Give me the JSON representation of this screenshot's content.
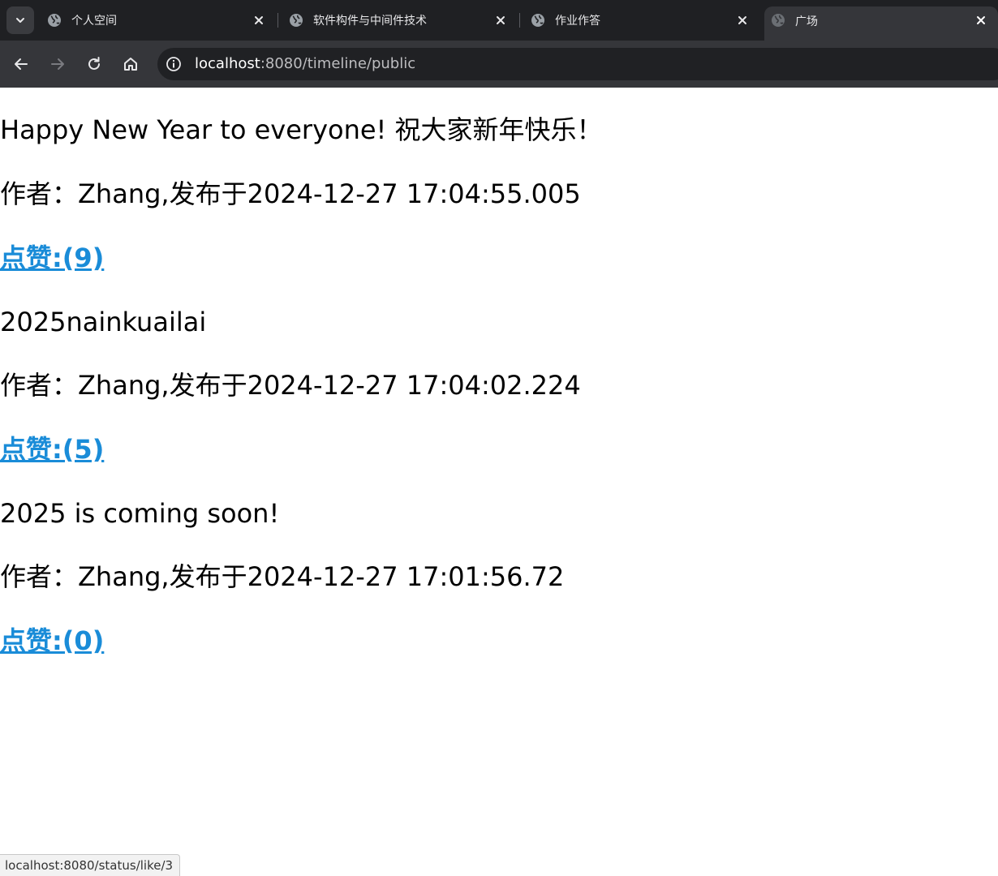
{
  "browser": {
    "tabs": [
      {
        "title": "个人空间",
        "active": false
      },
      {
        "title": "软件构件与中间件技术",
        "active": false
      },
      {
        "title": "作业作答",
        "active": false
      },
      {
        "title": "广场",
        "active": true
      }
    ],
    "address_bar": {
      "host": "localhost",
      "rest": ":8080/timeline/public"
    },
    "icons": {
      "tab_search": "chevron-down-icon",
      "tab_favicon": "globe-icon",
      "tab_close": "close-icon",
      "back": "arrow-left-icon",
      "forward": "arrow-right-icon",
      "reload": "reload-icon",
      "home": "home-icon",
      "site_info": "info-icon"
    }
  },
  "posts": [
    {
      "content": "Happy New Year to everyone! 祝大家新年快乐！",
      "meta": "作者：Zhang,发布于2024-12-27 17:04:55.005",
      "like_label": "点赞:(9)"
    },
    {
      "content": "2025nainkuailai",
      "meta": "作者：Zhang,发布于2024-12-27 17:04:02.224",
      "like_label": "点赞:(5)"
    },
    {
      "content": "2025 is coming soon!",
      "meta": "作者：Zhang,发布于2024-12-27 17:01:56.72",
      "like_label": "点赞:(0)"
    }
  ],
  "status_bar": {
    "hover_url": "localhost:8080/status/like/3"
  },
  "colors": {
    "chrome_dark": "#1f2023",
    "toolbar": "#35363a",
    "omnibox": "#202124",
    "link": "#1a8cd8"
  }
}
